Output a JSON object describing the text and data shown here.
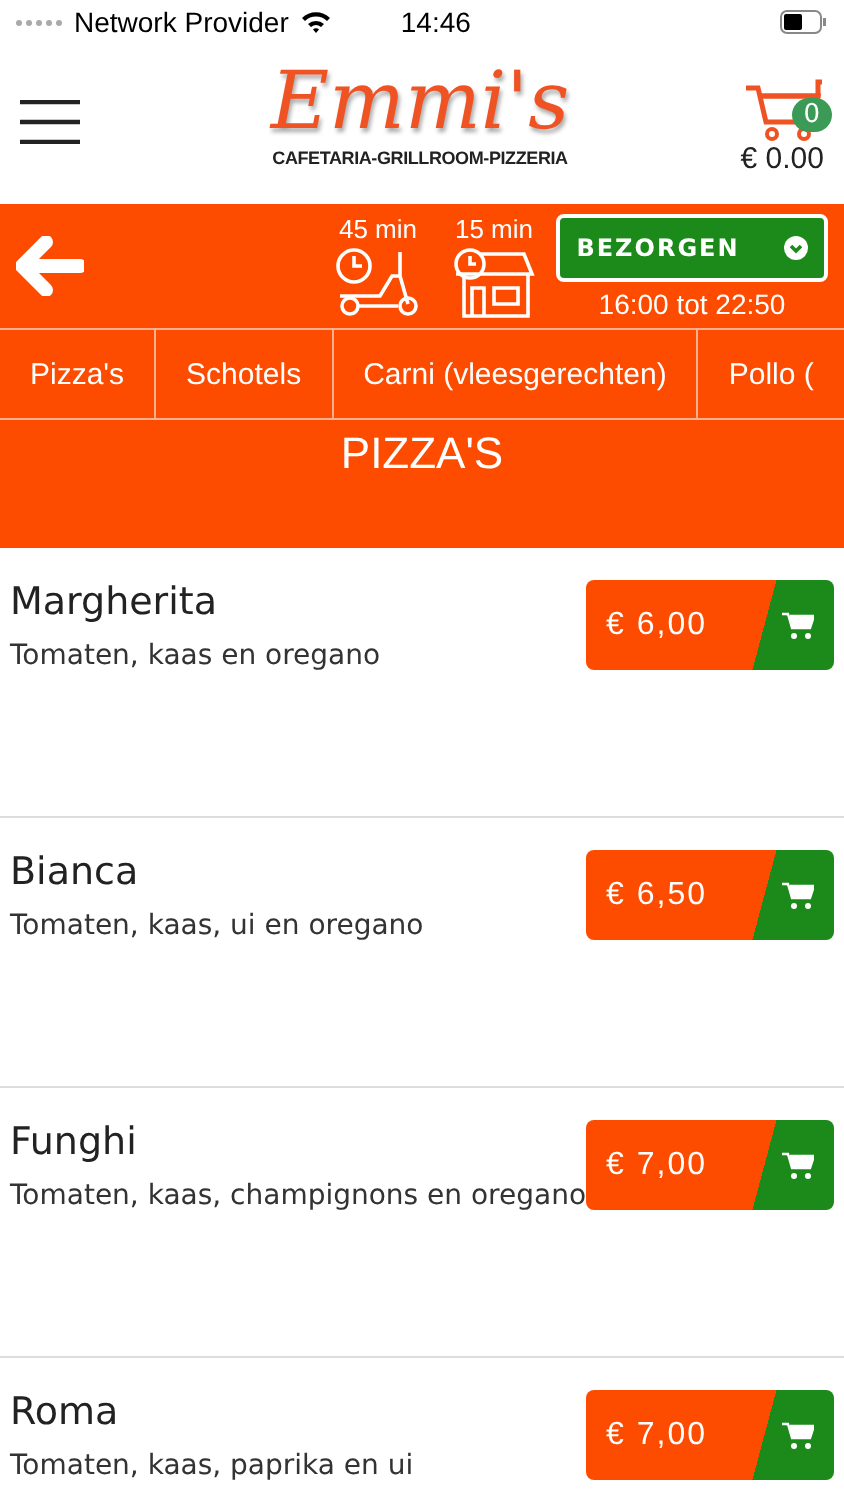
{
  "status_bar": {
    "carrier": "Network Provider",
    "time": "14:46"
  },
  "header": {
    "logo_title": "Emmi's",
    "logo_subtitle": "CAFETARIA-GRILLROOM-PIZZERIA",
    "cart_count": "0",
    "cart_total": "€ 0.00"
  },
  "order_bar": {
    "delivery_time": "45 min",
    "pickup_time": "15 min",
    "mode_button": "BEZORGEN",
    "hours": "16:00 tot 22:50"
  },
  "tabs": [
    {
      "label": "Pizza's"
    },
    {
      "label": "Schotels"
    },
    {
      "label": "Carni (vleesgerechten)"
    },
    {
      "label": "Pollo ("
    }
  ],
  "section_title": "PIZZA'S",
  "products": [
    {
      "name": "Margherita",
      "description": "Tomaten, kaas en oregano",
      "price": "€ 6,00"
    },
    {
      "name": "Bianca",
      "description": "Tomaten, kaas, ui en oregano",
      "price": "€ 6,50"
    },
    {
      "name": "Funghi",
      "description": "Tomaten, kaas, champignons en oregano",
      "price": "€ 7,00"
    },
    {
      "name": "Roma",
      "description": "Tomaten, kaas, paprika en ui",
      "price": "€ 7,00"
    }
  ]
}
